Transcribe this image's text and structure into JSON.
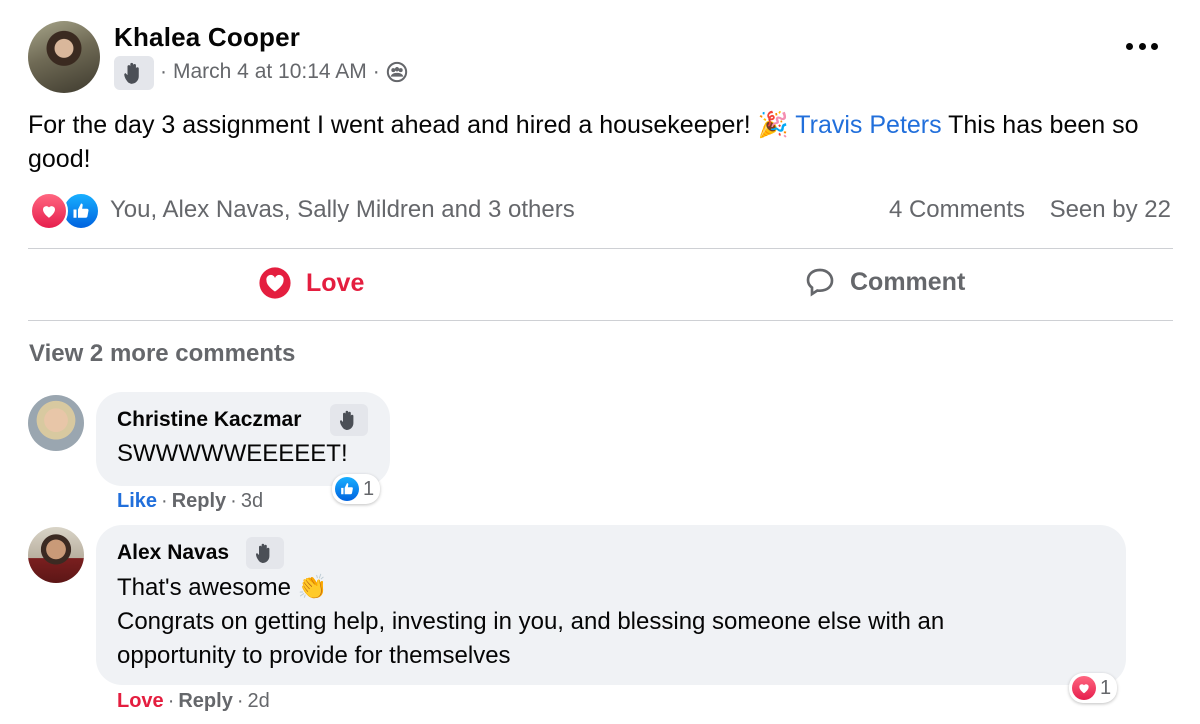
{
  "post": {
    "author": "Khalea Cooper",
    "timestamp": "March 4 at 10:14 AM",
    "separator": "·",
    "text_before": "For the day 3 assignment I went ahead and hired a housekeeper!",
    "text_emoji": "🎉",
    "mention": "Travis Peters",
    "text_after": "This has been so good!",
    "reactions_summary": "You, Alex Navas, Sally Mildren and 3 others",
    "comments_count": "4 Comments",
    "seen_by": "Seen by 22",
    "badge_icon": "waving-hand-icon",
    "audience_icon": "group-audience-icon"
  },
  "actions": {
    "love_label": "Love",
    "comment_label": "Comment"
  },
  "colors": {
    "love": "#e41e3f",
    "like": "#1877f2",
    "link": "#216fdb",
    "muted": "#65676b",
    "bubble": "#f0f2f5"
  },
  "view_more": "View 2 more comments",
  "comments": [
    {
      "author": "Christine Kaczmar",
      "text": "SWWWWWEEEEET!",
      "reaction": "Like",
      "reply": "Reply",
      "time": "3d",
      "reaction_count": "1",
      "reaction_icon": "like-icon"
    },
    {
      "author": "Alex Navas",
      "text_line1": "That's awesome",
      "text_emoji": "👏",
      "text_line2": "Congrats on getting help, investing in you, and blessing someone else with an",
      "text_line3": "opportunity to provide for themselves",
      "reaction": "Love",
      "reply": "Reply",
      "time": "2d",
      "reaction_count": "1",
      "reaction_icon": "love-icon"
    }
  ]
}
